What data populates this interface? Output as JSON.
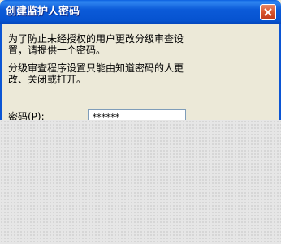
{
  "window": {
    "title": "创建监护人密码"
  },
  "content": {
    "para1_line1": "为了防止未经授权的用户更改分级审查设",
    "para1_line2": "置，请提供一个密码。",
    "para2_line1": "分级审查程序设置只能由知道密码的人更",
    "para2_line2": "改、关闭或打开。"
  },
  "form": {
    "password_label": "密码(P):",
    "password_value": "******"
  },
  "icons": {
    "close": "close-icon"
  }
}
